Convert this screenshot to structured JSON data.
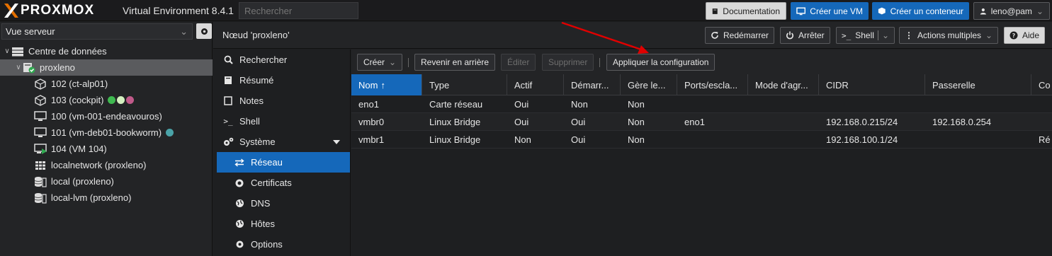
{
  "app": {
    "brand": "PROXMOX",
    "title": "Virtual Environment 8.4.1",
    "search_placeholder": "Rechercher",
    "buttons": {
      "documentation": "Documentation",
      "create_vm": "Créer une VM",
      "create_ct": "Créer un conteneur",
      "user": "leno@pam"
    }
  },
  "left": {
    "view_select": "Vue serveur",
    "tree": [
      {
        "label": "Centre de données",
        "icon": "datacenter-icon"
      },
      {
        "label": "proxleno",
        "icon": "node-online-icon"
      },
      {
        "label": "102 (ct-alp01)",
        "icon": "container-icon"
      },
      {
        "label": "103 (cockpit)",
        "icon": "container-icon"
      },
      {
        "label": "100 (vm-001-endeavouros)",
        "icon": "vm-icon"
      },
      {
        "label": "101 (vm-deb01-bookworm)",
        "icon": "vm-icon"
      },
      {
        "label": "104 (VM 104)",
        "icon": "vm-running-icon"
      },
      {
        "label": "localnetwork (proxleno)",
        "icon": "sdn-icon"
      },
      {
        "label": "local (proxleno)",
        "icon": "storage-icon"
      },
      {
        "label": "local-lvm (proxleno)",
        "icon": "storage-icon"
      }
    ],
    "tag_colors": {
      "cockpit": [
        "#3fb950",
        "#d4f0c0",
        "#c05a8a"
      ],
      "bookworm": [
        "#4aa3a8"
      ]
    }
  },
  "header": {
    "title": "Nœud 'proxleno'",
    "buttons": {
      "reboot": "Redémarrer",
      "shutdown": "Arrêter",
      "shell": "Shell",
      "bulk": "Actions multiples",
      "help": "Aide"
    }
  },
  "menu": [
    {
      "label": "Rechercher",
      "icon": "search-icon"
    },
    {
      "label": "Résumé",
      "icon": "book-icon"
    },
    {
      "label": "Notes",
      "icon": "notes-icon"
    },
    {
      "label": "Shell",
      "icon": "terminal-icon"
    },
    {
      "label": "Système",
      "icon": "cogs-icon"
    },
    {
      "label": "Réseau",
      "icon": "network-icon"
    },
    {
      "label": "Certificats",
      "icon": "certificate-icon"
    },
    {
      "label": "DNS",
      "icon": "globe-icon"
    },
    {
      "label": "Hôtes",
      "icon": "globe-icon"
    },
    {
      "label": "Options",
      "icon": "gear-icon"
    }
  ],
  "toolbar": {
    "create": "Créer",
    "revert": "Revenir en arrière",
    "edit": "Éditer",
    "delete": "Supprimer",
    "apply": "Appliquer la configuration"
  },
  "table": {
    "columns": [
      "Nom",
      "Type",
      "Actif",
      "Démarr...",
      "Gère le...",
      "Ports/escla...",
      "Mode d'agr...",
      "CIDR",
      "Passerelle",
      "Co"
    ],
    "rows": [
      [
        "eno1",
        "Carte réseau",
        "Oui",
        "Non",
        "Non",
        "",
        "",
        "",
        "",
        ""
      ],
      [
        "vmbr0",
        "Linux Bridge",
        "Oui",
        "Oui",
        "Non",
        "eno1",
        "",
        "192.168.0.215/24",
        "192.168.0.254",
        ""
      ],
      [
        "vmbr1",
        "Linux Bridge",
        "Non",
        "Oui",
        "Non",
        "",
        "",
        "192.168.100.1/24",
        "",
        "Ré"
      ]
    ]
  },
  "colors": {
    "accent": "#1568ba",
    "annotation_arrow": "#e00000"
  }
}
